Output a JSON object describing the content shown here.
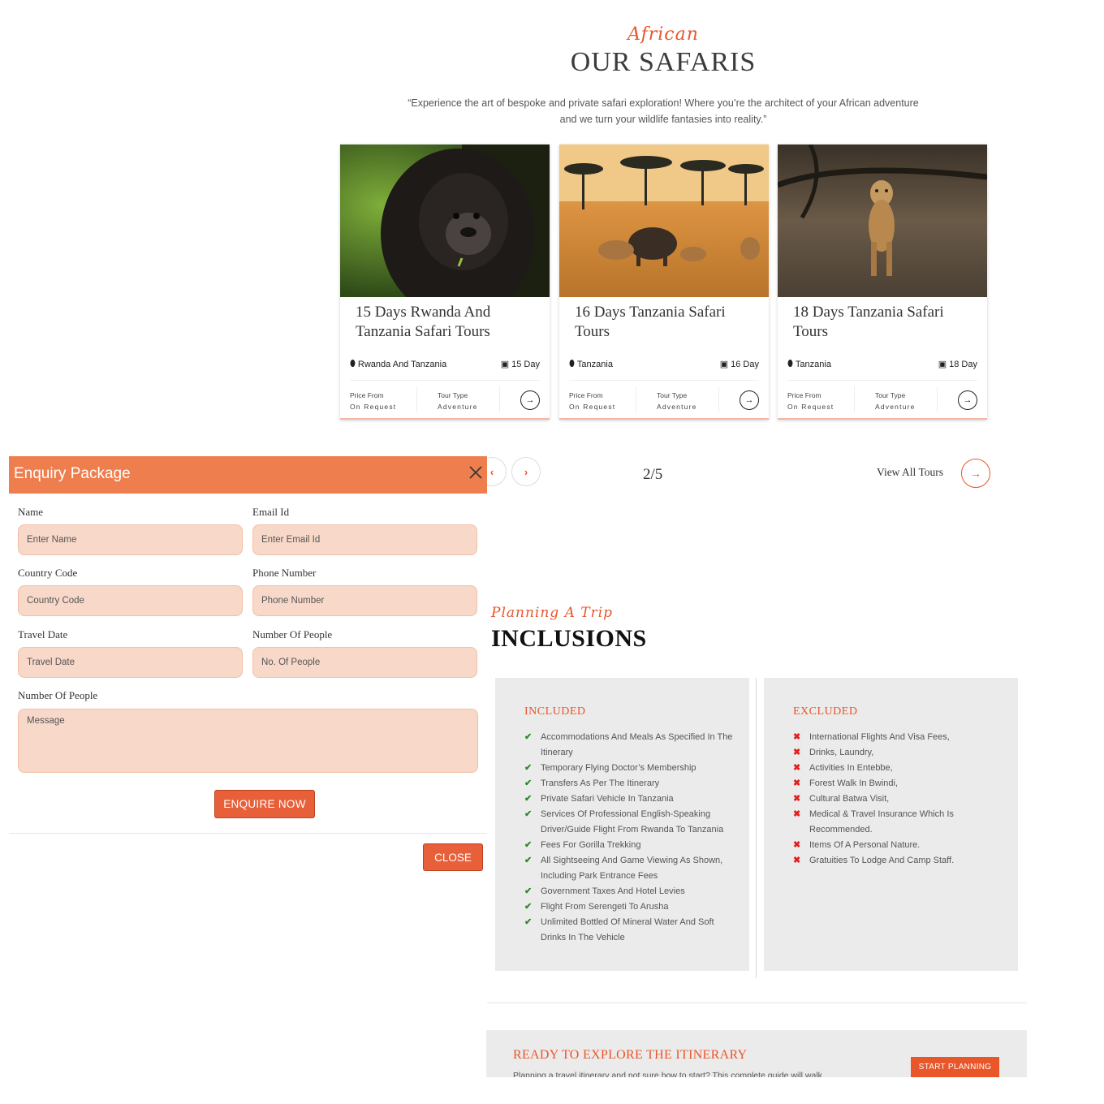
{
  "safaris": {
    "eyebrow": "African",
    "title": "OUR SAFARIS",
    "intro": "“Experience the art of bespoke and private safari exploration! Where you’re the architect of your African adventure and we turn your wildlife fantasies into reality.”",
    "cards": [
      {
        "title": "15 Days Rwanda And Tanzania Safari Tours",
        "location": "Rwanda And Tanzania",
        "duration": "15 Day",
        "price_label": "Price From",
        "price_value": "On Request",
        "type_label": "Tour Type",
        "type_value": "Adventure"
      },
      {
        "title": "16 Days Tanzania Safari Tours",
        "location": "Tanzania",
        "duration": "16 Day",
        "price_label": "Price From",
        "price_value": "On Request",
        "type_label": "Tour Type",
        "type_value": "Adventure"
      },
      {
        "title": "18 Days Tanzania Safari Tours",
        "location": "Tanzania",
        "duration": "18 Day",
        "price_label": "Price From",
        "price_value": "On Request",
        "type_label": "Tour Type",
        "type_value": "Adventure"
      }
    ],
    "pager": "2/5",
    "view_all": "View All Tours"
  },
  "modal": {
    "title": "Enquiry Package",
    "fields": {
      "name": {
        "label": "Name",
        "placeholder": "Enter Name"
      },
      "email": {
        "label": "Email Id",
        "placeholder": "Enter Email Id"
      },
      "country": {
        "label": "Country Code",
        "placeholder": "Country Code"
      },
      "phone": {
        "label": "Phone Number",
        "placeholder": "Phone Number"
      },
      "date": {
        "label": "Travel Date",
        "placeholder": "Travel Date"
      },
      "people": {
        "label": "Number Of People",
        "placeholder": "No. Of People"
      },
      "message": {
        "label": "Number Of People",
        "placeholder": "Message"
      }
    },
    "submit": "ENQUIRE NOW",
    "close": "CLOSE"
  },
  "inclusions": {
    "eyebrow": "Planning A Trip",
    "title": "INCLUSIONS",
    "included_head": "INCLUDED",
    "included": [
      "Accommodations And Meals As Specified In The Itinerary",
      "Temporary Flying Doctor’s Membership",
      "Transfers As Per The Itinerary",
      "Private Safari Vehicle In Tanzania",
      "Services Of Professional English-Speaking Driver/Guide Flight From Rwanda To Tanzania",
      "Fees For Gorilla Trekking",
      "All Sightseeing And Game Viewing As Shown, Including Park Entrance Fees",
      "Government Taxes And Hotel Levies",
      "Flight From Serengeti To Arusha",
      "Unlimited Bottled Of Mineral Water And Soft Drinks In The Vehicle"
    ],
    "excluded_head": "EXCLUDED",
    "excluded": [
      "International Flights And Visa Fees,",
      "Drinks, Laundry,",
      "Activities In Entebbe,",
      "Forest Walk In Bwindi,",
      "Cultural Batwa Visit,",
      "Medical & Travel Insurance Which Is Recommended.",
      "Items Of A Personal Nature.",
      "Gratuities To Lodge And Camp Staff."
    ]
  },
  "ready": {
    "title": "READY TO EXPLORE THE ITINERARY",
    "text": "Planning a travel itinerary and not sure how to start? This complete guide will walk",
    "button": "START PLANNING"
  },
  "colors": {
    "accent": "#e8562a",
    "modal_header": "#ee7e4e",
    "input_bg": "#f8d8c8",
    "panel_bg": "#ebebeb"
  }
}
